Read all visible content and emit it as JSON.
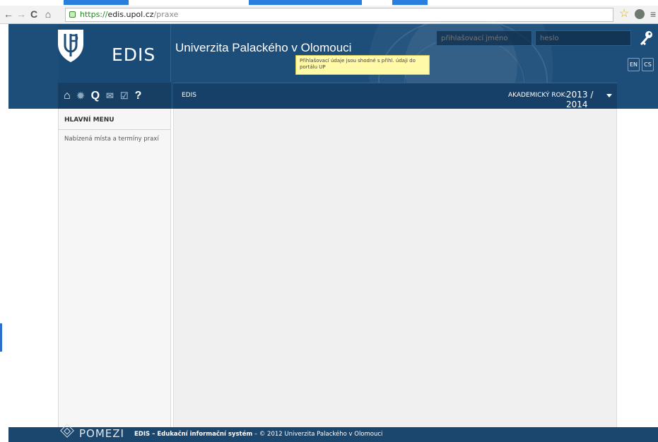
{
  "browser": {
    "url_protocol": "https://",
    "url_host": "edis.upol.cz",
    "url_path": "/praxe"
  },
  "header": {
    "logo_text": "EDIS",
    "university_name": "Univerzita Palackého v Olomouci",
    "username_placeholder": "přihlašovací jméno",
    "password_placeholder": "heslo",
    "tooltip": "Přihlašovací údaje jsou shodné s přihl. údaji do portálu UP",
    "lang_en": "EN",
    "lang_cs": "CS"
  },
  "toolbar": {
    "breadcrumb": "EDIS",
    "year_label": "AKADEMICKÝ ROK:",
    "year_value": "2013 / 2014"
  },
  "sidebar": {
    "heading": "HLAVNÍ MENU",
    "items": [
      {
        "label": "Nabízená místa a termíny praxí"
      }
    ]
  },
  "footer": {
    "pomezi": "POMEZI",
    "system_name": "EDIS – Edukační informační systém",
    "copyright": " – © 2012 Univerzita Palackého v Olomouci"
  },
  "colors": {
    "header_bg": "#1d4e7a",
    "tooltip_bg": "#fff9a8",
    "content_bg": "#f0f0f1"
  },
  "icons": [
    "home-icon",
    "settings-icon",
    "search-icon",
    "mail-icon",
    "checklist-icon",
    "help-icon",
    "key-icon"
  ]
}
